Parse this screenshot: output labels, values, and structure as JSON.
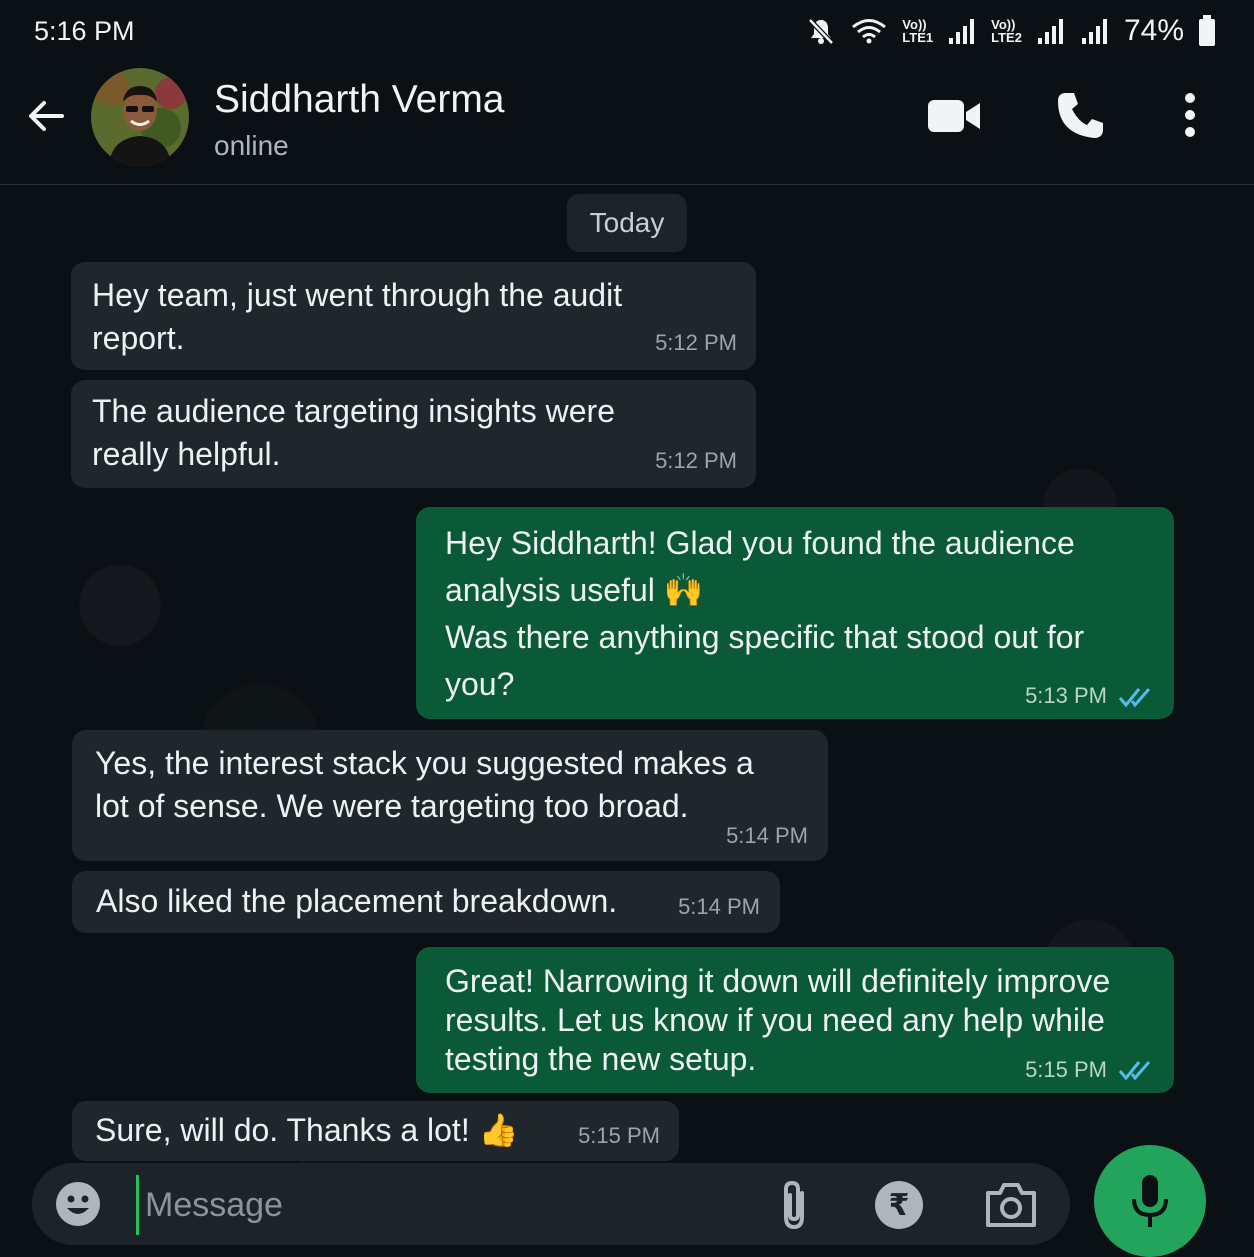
{
  "status_bar": {
    "time": "5:16 PM",
    "sim1": "Vo))\nLTE1",
    "sim2": "Vo))\nLTE2",
    "battery": "74%"
  },
  "header": {
    "contact_name": "Siddharth Verma",
    "contact_status": "online",
    "icons": [
      "back-arrow-icon",
      "video-call-icon",
      "phone-call-icon",
      "more-options-icon"
    ]
  },
  "chat": {
    "date_label": "Today",
    "messages": [
      {
        "direction": "incoming",
        "text": "Hey team, just went through the audit report.",
        "time": "5:12 PM"
      },
      {
        "direction": "incoming",
        "text": "The audience targeting insights were really helpful.",
        "time": "5:12 PM"
      },
      {
        "direction": "outgoing",
        "text": "Hey Siddharth! Glad you found the audience analysis useful 🙌\nWas there anything specific that stood out for you?",
        "time": "5:13 PM",
        "status": "read"
      },
      {
        "direction": "incoming",
        "text": "Yes, the interest stack you suggested makes a lot of sense. We were targeting too broad.",
        "time": "5:14 PM"
      },
      {
        "direction": "incoming",
        "text": "Also liked the placement breakdown.",
        "time": "5:14 PM"
      },
      {
        "direction": "outgoing",
        "text": "Great! Narrowing it down will definitely improve results. Let us know if you need any help while testing the new setup.",
        "time": "5:15 PM",
        "status": "read"
      },
      {
        "direction": "incoming",
        "text": "Sure, will do. Thanks a lot! 👍",
        "time": "5:15 PM"
      }
    ]
  },
  "composer": {
    "placeholder": "Message",
    "value": "",
    "icons": [
      "emoji-icon",
      "attach-icon",
      "rupee-payment-icon",
      "camera-icon",
      "microphone-icon"
    ]
  },
  "colors": {
    "incoming_bubble": "#1f272c",
    "outgoing_bubble": "#0a5a38",
    "accent": "#22a45c",
    "read_ticks": "#53bdeb"
  }
}
